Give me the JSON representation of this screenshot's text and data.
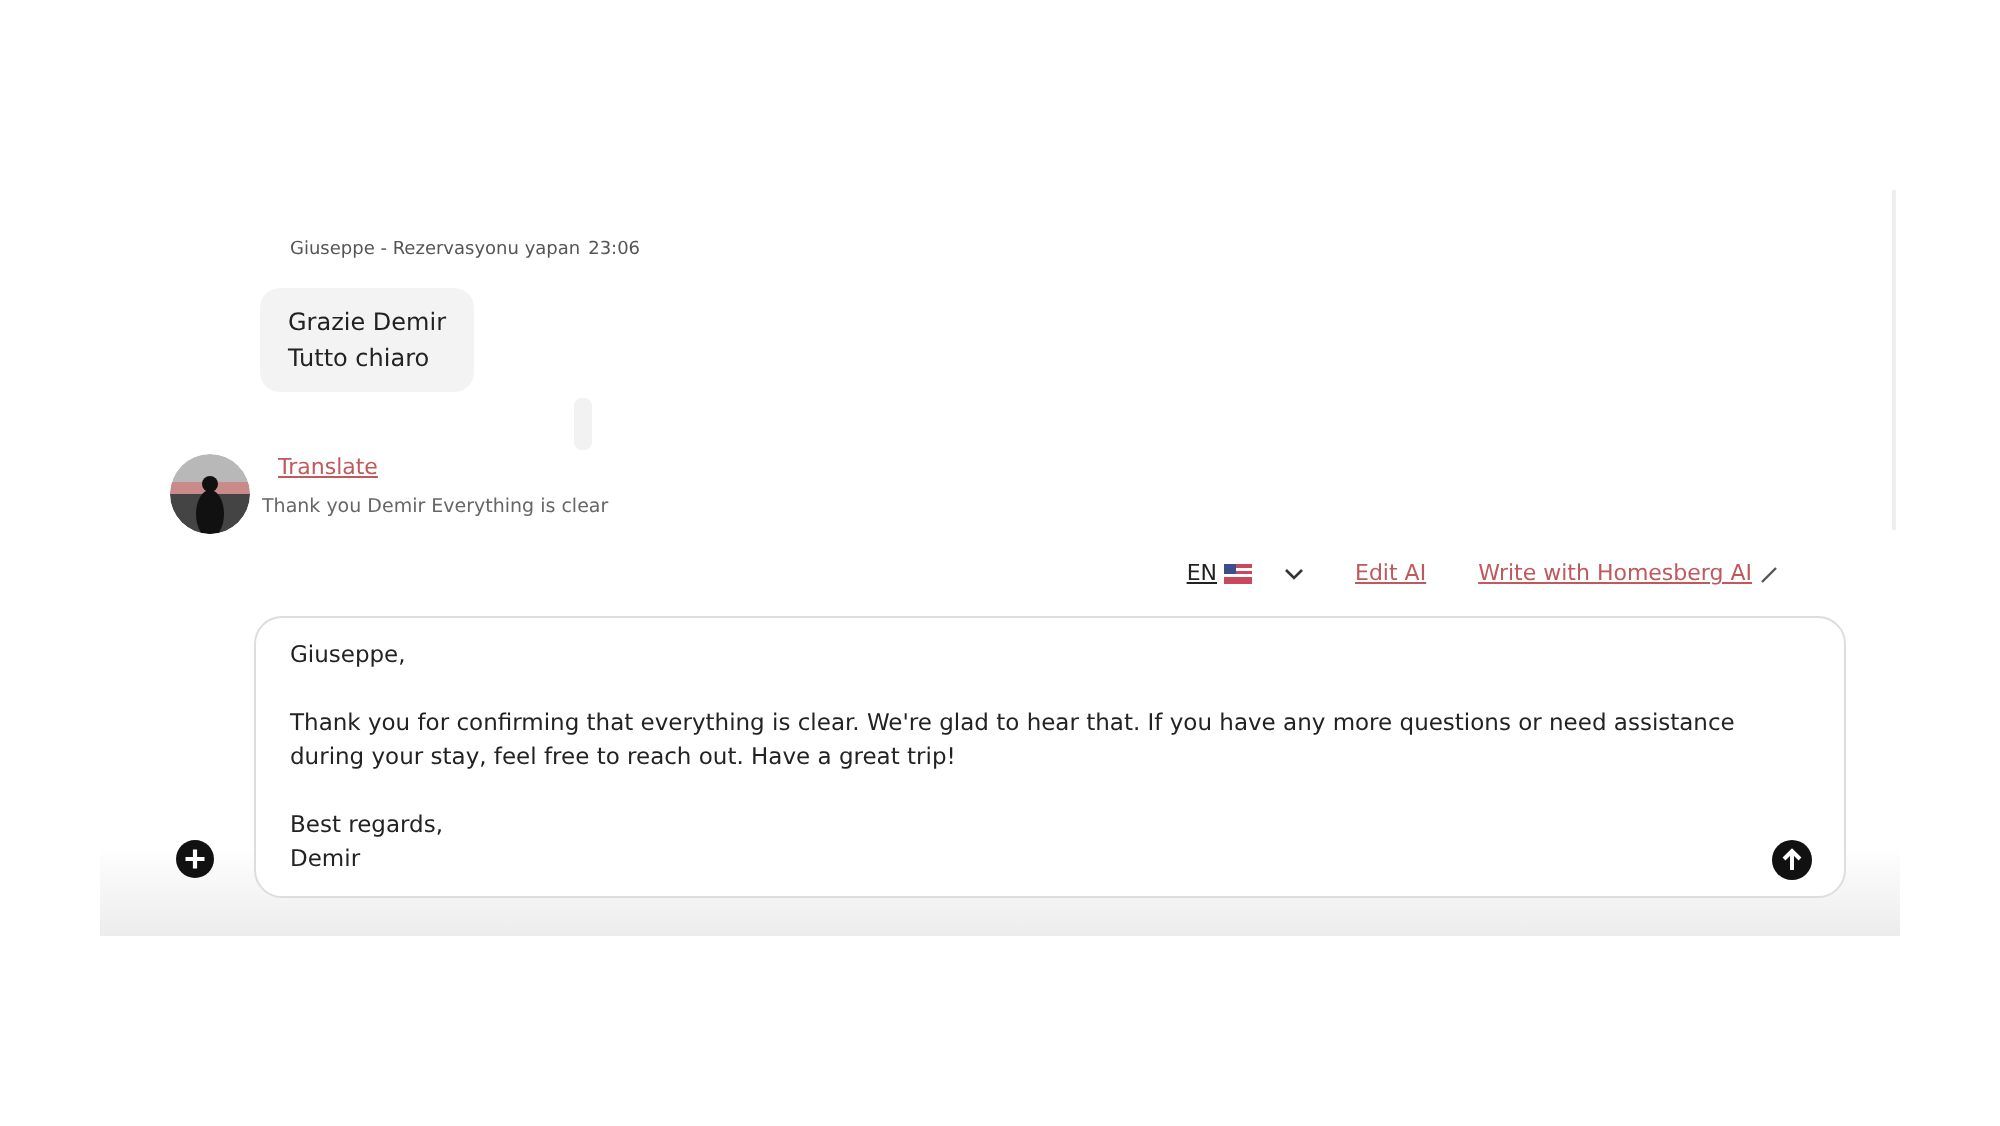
{
  "message": {
    "sender": "Giuseppe - Rezervasyonu yapan",
    "time": "23:06",
    "lines": [
      "Grazie Demir",
      "Tutto chiaro"
    ],
    "translate_link": "Translate",
    "translation": "Thank you Demir Everything is clear"
  },
  "toolbar": {
    "language": "EN",
    "edit_link": "Edit AI",
    "write_link": "Write with Homesberg AI"
  },
  "composer": {
    "value": "Giuseppe,\n\nThank you for confirming that everything is clear. We're glad to hear that. If you have any more questions or need assistance during your stay, feel free to reach out. Have a great trip!\n\nBest regards,\nDemir"
  }
}
